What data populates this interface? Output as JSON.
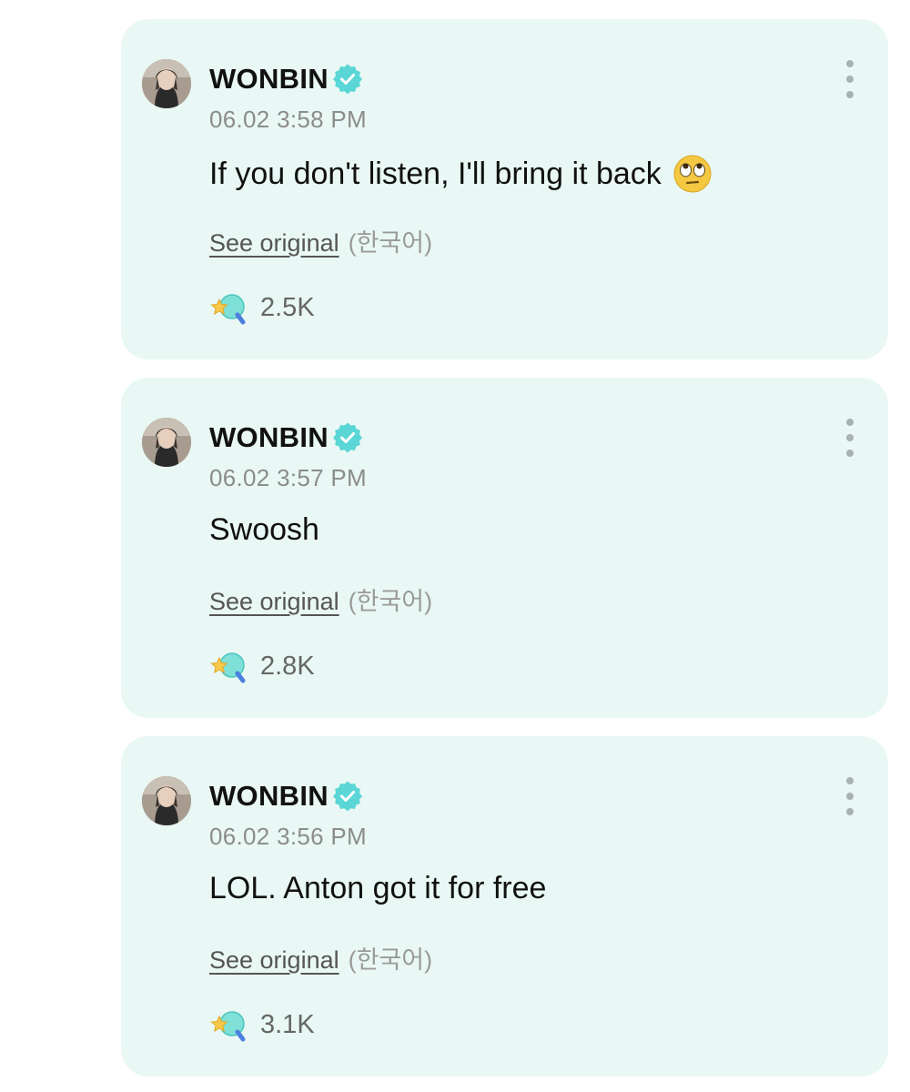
{
  "accent_color": "#5ad6d6",
  "card_background": "#e9f8f4",
  "posts": [
    {
      "author": "WONBIN",
      "verified_icon": "verified-badge-icon",
      "timestamp": "06.02 3:58 PM",
      "text": "If you don't listen, I'll bring it back",
      "emoji": "eye-roll-emoji",
      "see_original_label": "See original",
      "language_label": "(한국어)",
      "reaction_icon": "reaction-icon",
      "reaction_count": "2.5K",
      "more_icon": "more-vertical-icon"
    },
    {
      "author": "WONBIN",
      "verified_icon": "verified-badge-icon",
      "timestamp": "06.02 3:57 PM",
      "text": "Swoosh",
      "see_original_label": "See original",
      "language_label": "(한국어)",
      "reaction_icon": "reaction-icon",
      "reaction_count": "2.8K",
      "more_icon": "more-vertical-icon"
    },
    {
      "author": "WONBIN",
      "verified_icon": "verified-badge-icon",
      "timestamp": "06.02 3:56 PM",
      "text": "LOL. Anton got it for free",
      "see_original_label": "See original",
      "language_label": "(한국어)",
      "reaction_icon": "reaction-icon",
      "reaction_count": "3.1K",
      "more_icon": "more-vertical-icon"
    }
  ]
}
